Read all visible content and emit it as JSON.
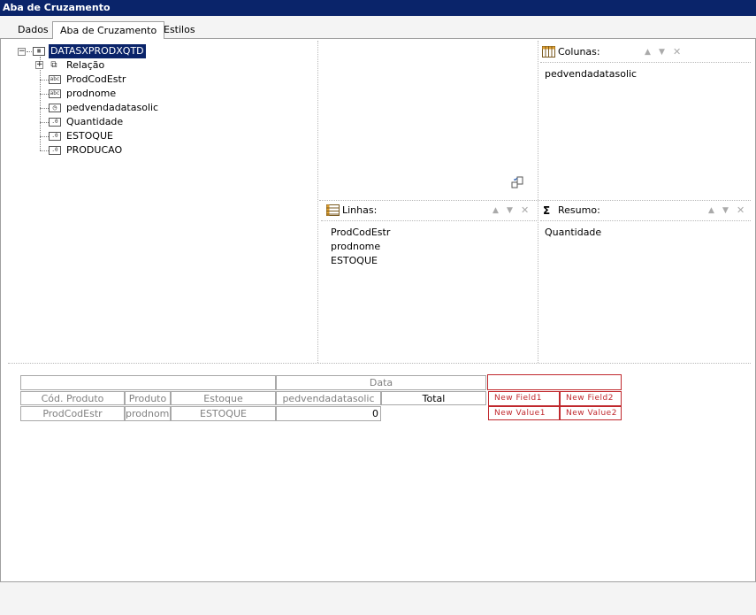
{
  "window": {
    "title": "Aba de Cruzamento"
  },
  "tabs": [
    {
      "label": "Dados",
      "active": false
    },
    {
      "label": "Aba de Cruzamento",
      "active": true
    },
    {
      "label": "Estilos",
      "active": false
    }
  ],
  "tree": {
    "root": {
      "label": "DATASXPRODXQTD",
      "icon": "table-icon"
    },
    "children": [
      {
        "label": "Relação",
        "icon": "relation-icon",
        "expandable": true
      },
      {
        "label": "ProdCodEstr",
        "icon": "text-field-icon"
      },
      {
        "label": "prodnome",
        "icon": "text-field-icon"
      },
      {
        "label": "pedvendadatasolic",
        "icon": "date-field-icon"
      },
      {
        "label": "Quantidade",
        "icon": "number-field-icon"
      },
      {
        "label": "ESTOQUE",
        "icon": "number-field-icon"
      },
      {
        "label": "PRODUCAO",
        "icon": "number-field-icon"
      }
    ]
  },
  "panels": {
    "colunas": {
      "title": "Colunas:",
      "items": [
        "pedvendadatasolic"
      ]
    },
    "linhas": {
      "title": "Linhas:",
      "items": [
        "ProdCodEstr",
        "prodnome",
        "ESTOQUE"
      ]
    },
    "resumo": {
      "title": "Resumo:",
      "items": [
        "Quantidade"
      ]
    }
  },
  "preview": {
    "data_header": "Data",
    "row_headers": [
      "Cód. Produto",
      "Produto",
      "Estoque"
    ],
    "column_field": "pedvendadatasolic",
    "total_label": "Total",
    "row_values": [
      "ProdCodEstr",
      "prodnome",
      "ESTOQUE"
    ],
    "value_cell": "0",
    "new_fields": [
      "New Field1",
      "New Field2"
    ],
    "new_values": [
      "New Value1",
      "New Value2"
    ]
  },
  "colors": {
    "titlebar": "#0a246a",
    "selection": "#0a246a",
    "new_field_border": "#c0282d"
  }
}
